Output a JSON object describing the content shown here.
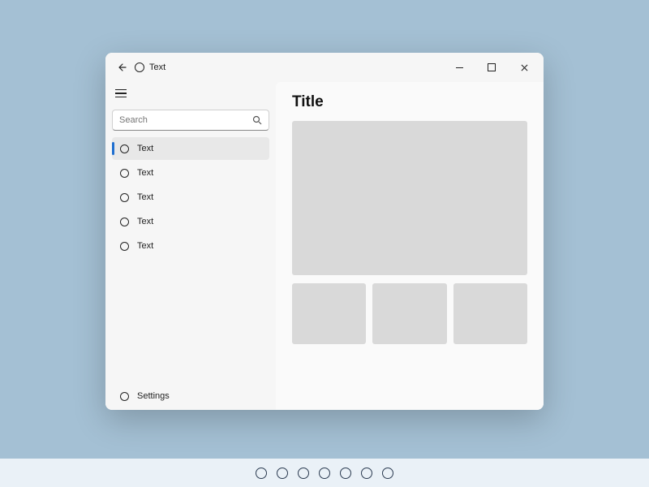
{
  "titlebar": {
    "title": "Text"
  },
  "sidebar": {
    "search_placeholder": "Search",
    "items": [
      {
        "label": "Text",
        "selected": true
      },
      {
        "label": "Text",
        "selected": false
      },
      {
        "label": "Text",
        "selected": false
      },
      {
        "label": "Text",
        "selected": false
      },
      {
        "label": "Text",
        "selected": false
      }
    ],
    "settings_label": "Settings"
  },
  "content": {
    "title": "Title"
  },
  "taskbar": {
    "item_count": 7
  }
}
